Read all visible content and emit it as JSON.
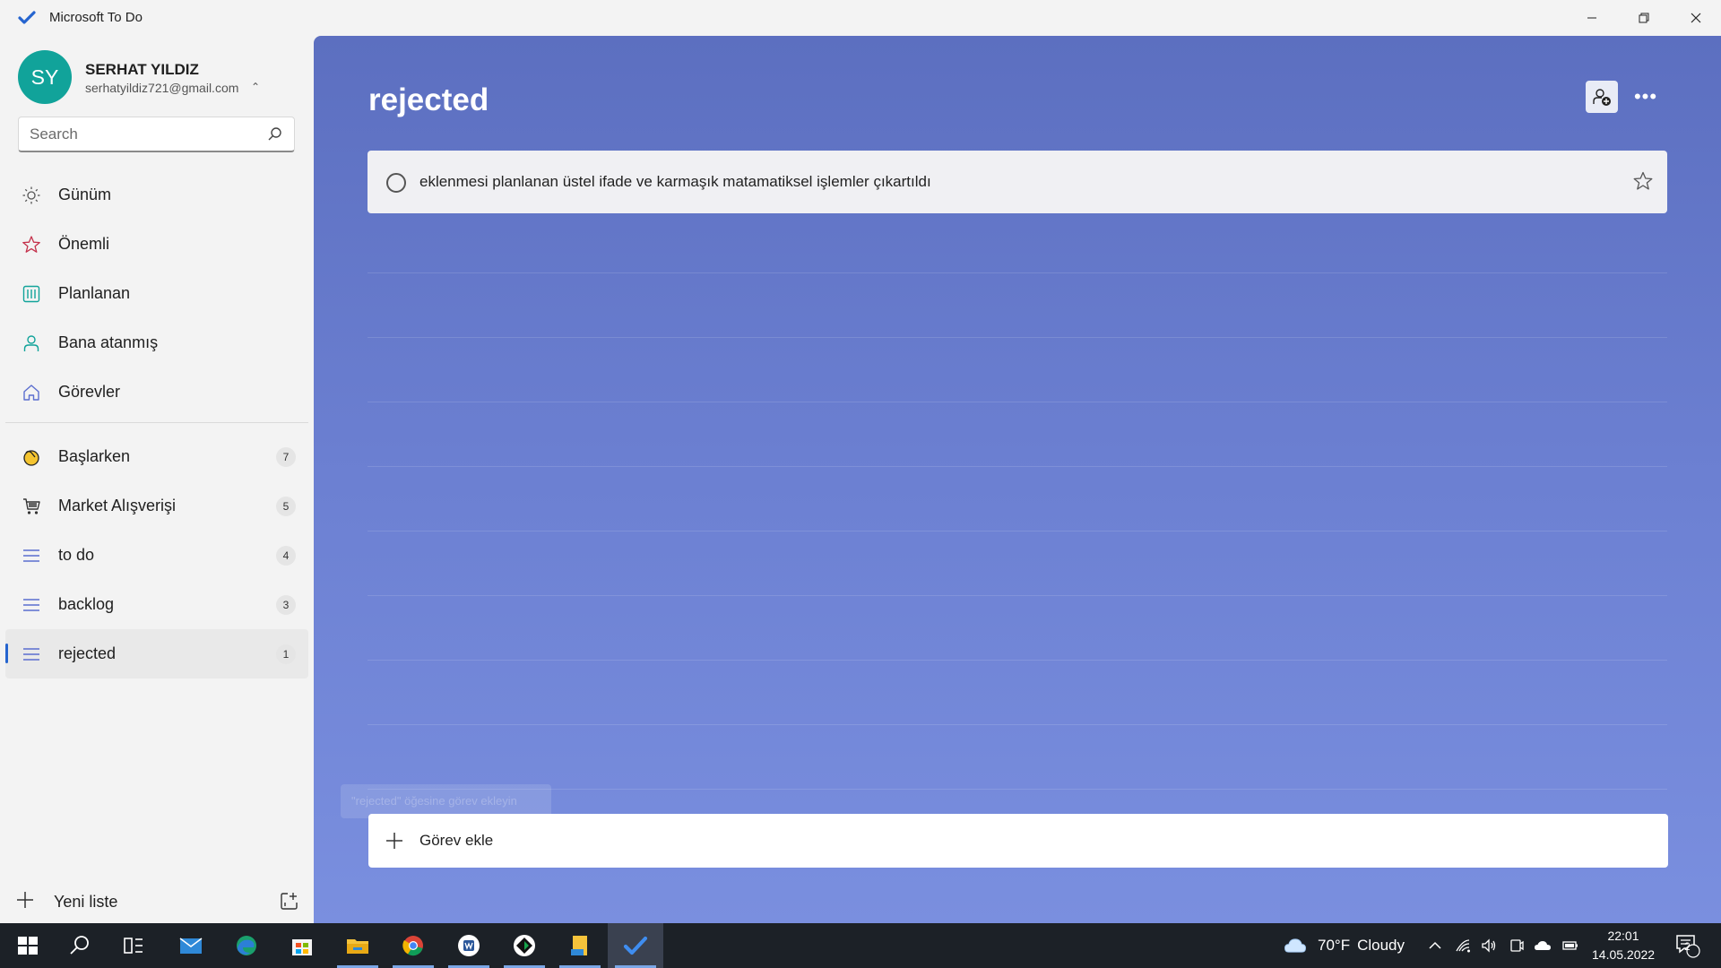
{
  "titlebar": {
    "title": "Microsoft To Do"
  },
  "profile": {
    "initials": "SY",
    "name": "SERHAT YILDIZ",
    "email": "serhatyildiz721@gmail.com",
    "avatar_color": "#11a39a"
  },
  "search": {
    "placeholder": "Search"
  },
  "sidebar": {
    "smart_lists": [
      {
        "label": "Günüm",
        "icon": "sun-icon"
      },
      {
        "label": "Önemli",
        "icon": "star-icon"
      },
      {
        "label": "Planlanan",
        "icon": "calendar-icon"
      },
      {
        "label": "Bana atanmış",
        "icon": "person-icon"
      },
      {
        "label": "Görevler",
        "icon": "home-icon"
      }
    ],
    "lists": [
      {
        "label": "Başlarken",
        "count": "7",
        "icon": "wave-hand-icon"
      },
      {
        "label": "Market Alışverişi",
        "count": "5",
        "icon": "cart-icon"
      },
      {
        "label": "to do",
        "count": "4",
        "icon": "list-icon"
      },
      {
        "label": "backlog",
        "count": "3",
        "icon": "list-icon"
      },
      {
        "label": "rejected",
        "count": "1",
        "icon": "list-icon",
        "active": true
      }
    ],
    "new_list_label": "Yeni liste"
  },
  "main": {
    "title": "rejected",
    "background_color": "#6579c9",
    "tasks": [
      {
        "text": "eklenmesi planlanan üstel ifade ve karmaşık matamatiksel işlemler çıkartıldı",
        "completed": false,
        "important": false
      }
    ],
    "hint_text": "\"rejected\" öğesine görev ekleyin",
    "add_task_label": "Görev ekle"
  },
  "taskbar": {
    "weather_temp": "70°F",
    "weather_text": "Cloudy",
    "time": "22:01",
    "date": "14.05.2022",
    "notification_count": "2",
    "accent": "#7aa6e6"
  }
}
